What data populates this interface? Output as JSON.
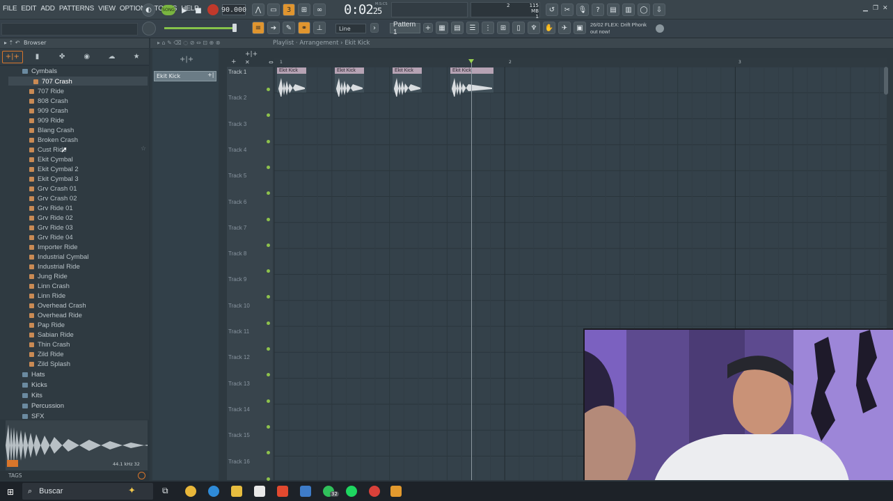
{
  "menu": [
    "FILE",
    "EDIT",
    "ADD",
    "PATTERNS",
    "VIEW",
    "OPTIONS",
    "TOOLS",
    "HELP"
  ],
  "transport": {
    "song_mode": "SONG",
    "tempo": "90.000",
    "time_main": "0:02",
    "time_sub": "25",
    "time_unit": "M:S:CS",
    "cpu_top": "115 MB",
    "cpu_bottom": "1",
    "cpu_num": "2"
  },
  "toolbar2": {
    "snap": "Line",
    "pattern": "Pattern 1",
    "news_line1": "26/02  FLEX: Drift Phonk",
    "news_line2": "out now!"
  },
  "browser": {
    "title": "Browser",
    "open_folder": "Cymbals",
    "selected_item": "707 Crash",
    "files": [
      "707 Ride",
      "808 Crash",
      "909 Crash",
      "909 Ride",
      "Blang Crash",
      "Broken Crash",
      "Cust Ride",
      "Ekit Cymbal",
      "Ekit Cymbal 2",
      "Ekit Cymbal 3",
      "Grv Crash 01",
      "Grv Crash 02",
      "Grv Ride 01",
      "Grv Ride 02",
      "Grv Ride 03",
      "Grv Ride 04",
      "Importer Ride",
      "Industrial Cymbal",
      "Industrial Ride",
      "Jung Ride",
      "Linn Crash",
      "Linn Ride",
      "Overhead Crash",
      "Overhead Ride",
      "Pap Ride",
      "Sabian Ride",
      "Thin Crash",
      "Zild Ride",
      "Zild Splash"
    ],
    "folders_after": [
      "Hats",
      "Kicks",
      "Kits",
      "Percussion",
      "SFX"
    ],
    "tags_label": "TAGS",
    "wave_info": "44.1 kHz  32"
  },
  "playlist": {
    "title": "Playlist · Arrangement › Ekit Kick",
    "picker_item": "Ekit Kick",
    "ruler_marks": [
      "1",
      "2",
      "3"
    ],
    "tracks": [
      "Track 1",
      "Track 2",
      "Track 3",
      "Track 4",
      "Track 5",
      "Track 6",
      "Track 7",
      "Track 8",
      "Track 9",
      "Track 10",
      "Track 11",
      "Track 12",
      "Track 13",
      "Track 14",
      "Track 15",
      "Track 16"
    ],
    "clips": [
      "Ekit Kick",
      "Ekit Kick",
      "Ekit Kick",
      "Ekit Kick"
    ]
  },
  "taskbar": {
    "search_placeholder": "Buscar",
    "whatsapp_badge": "32"
  },
  "colors": {
    "accent_orange": "#e08a3c",
    "accent_green": "#8ec24c",
    "clip_header": "#b6a3b4"
  }
}
